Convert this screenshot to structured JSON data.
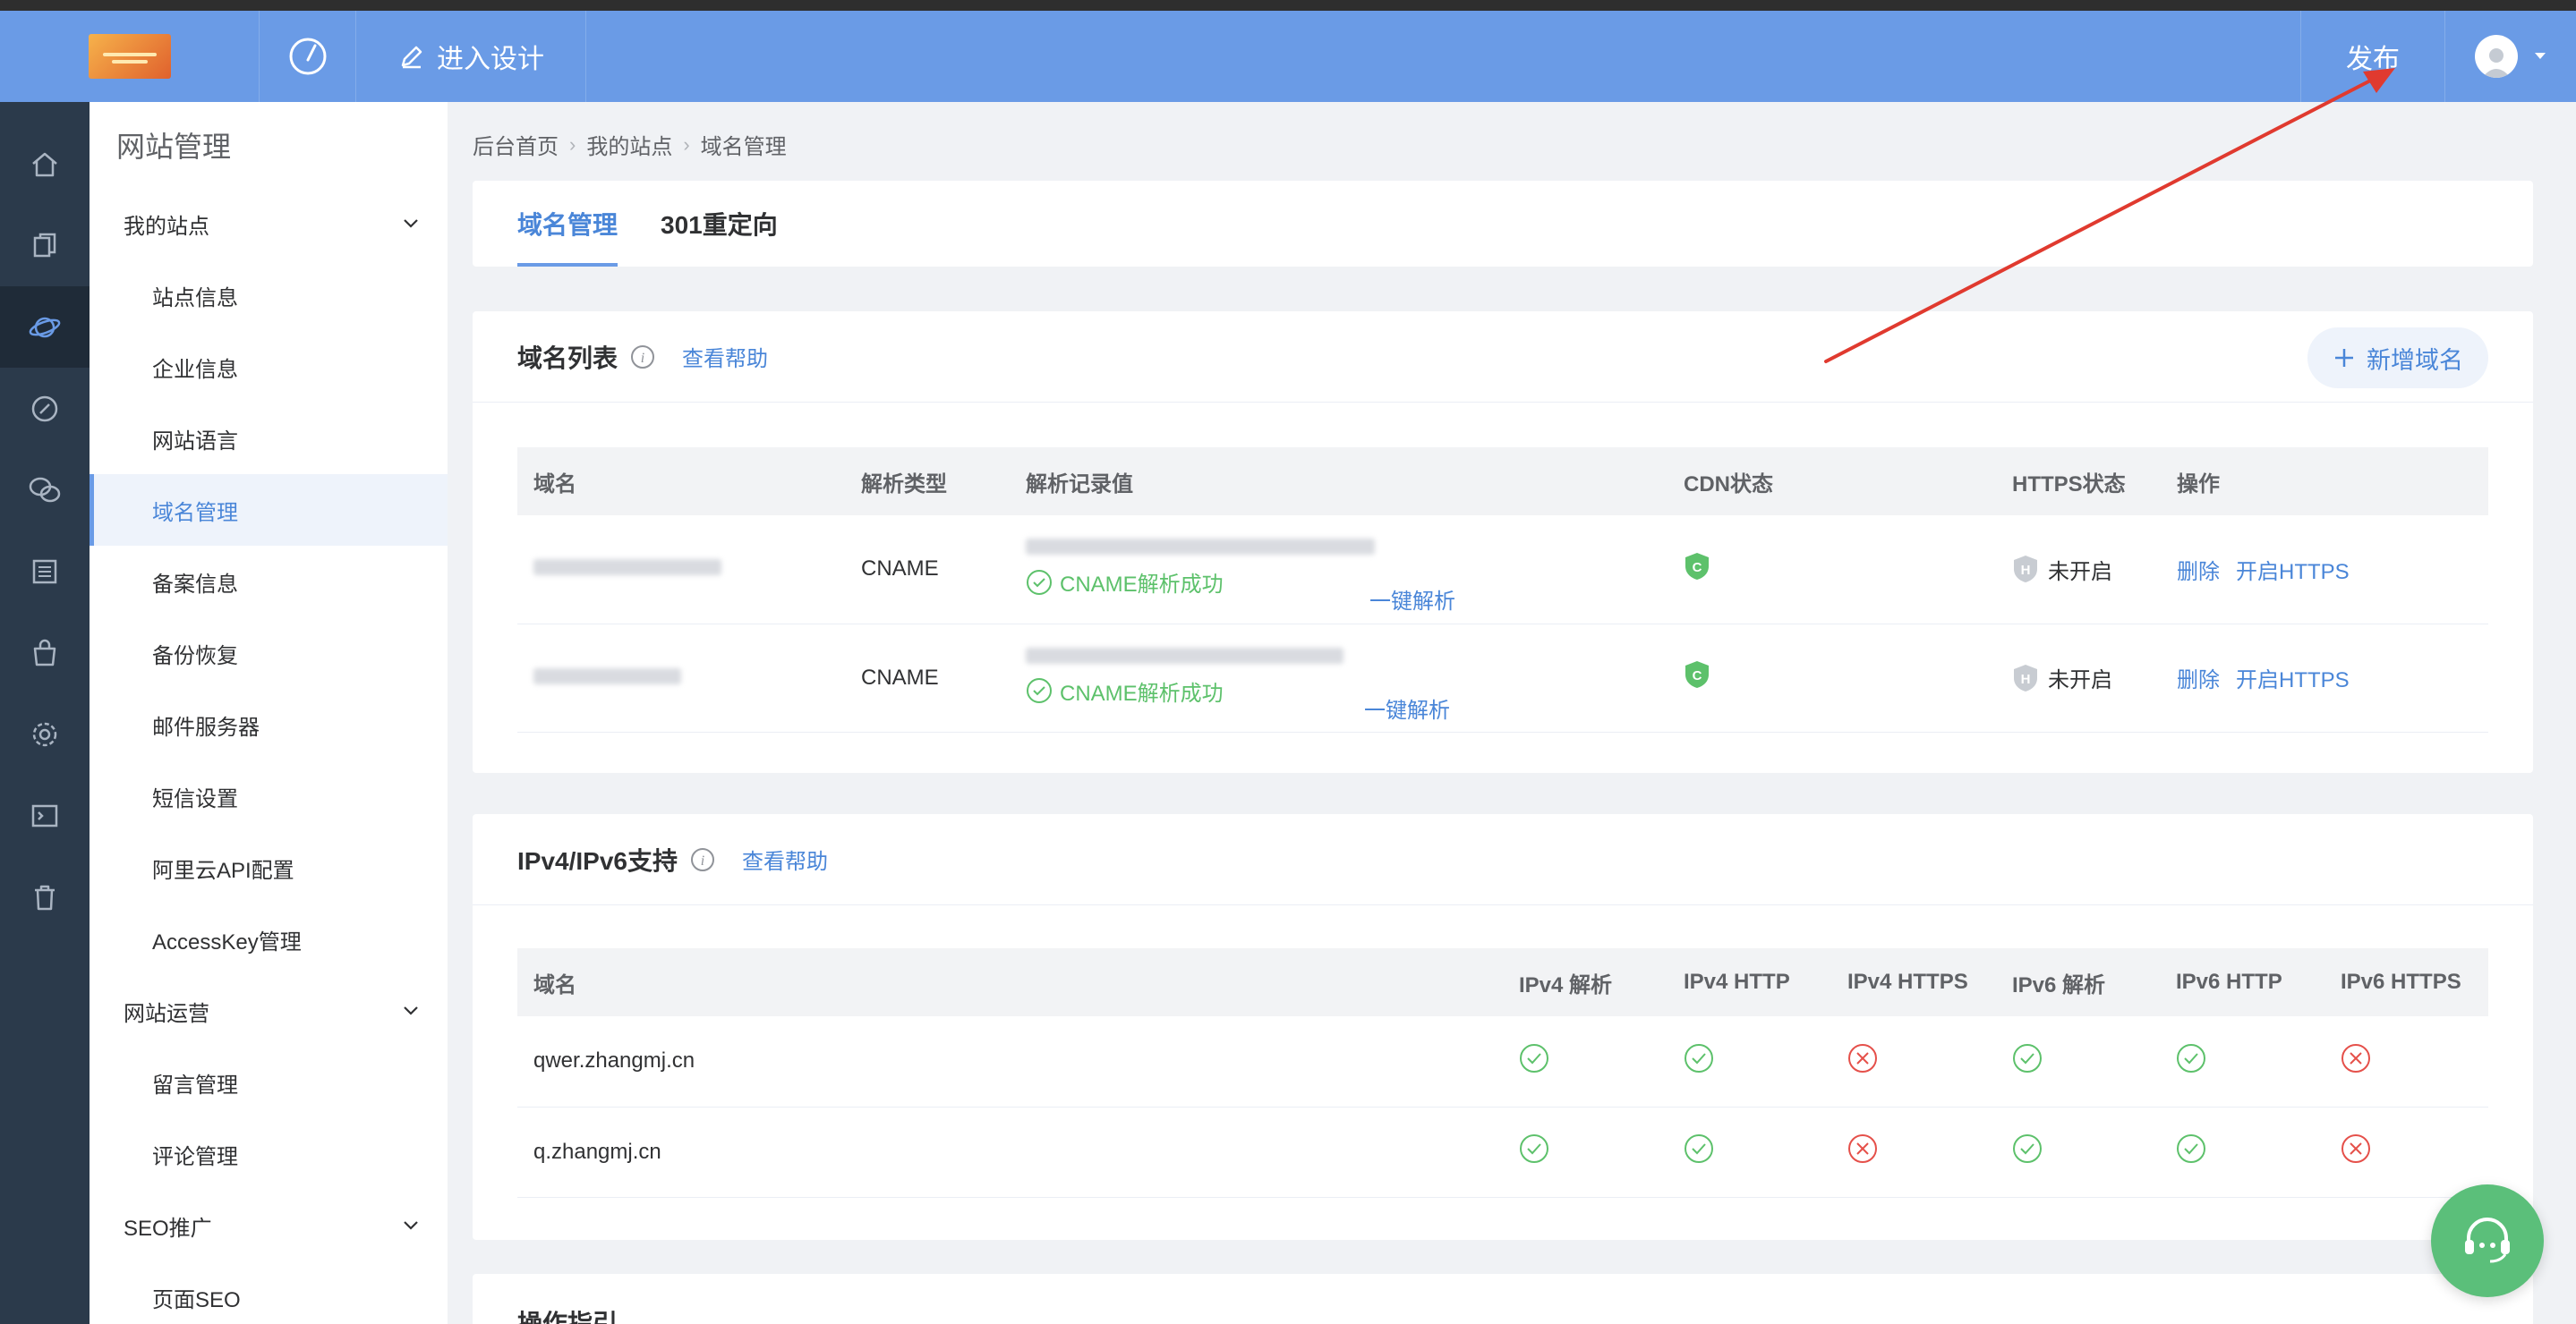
{
  "header": {
    "design_label": "进入设计",
    "publish_label": "发布"
  },
  "sidebar": {
    "title": "网站管理",
    "groups": [
      {
        "label": "我的站点"
      },
      {
        "label": "网站运营"
      },
      {
        "label": "SEO推广"
      }
    ],
    "items": [
      {
        "label": "站点信息"
      },
      {
        "label": "企业信息"
      },
      {
        "label": "网站语言"
      },
      {
        "label": "域名管理"
      },
      {
        "label": "备案信息"
      },
      {
        "label": "备份恢复"
      },
      {
        "label": "邮件服务器"
      },
      {
        "label": "短信设置"
      },
      {
        "label": "阿里云API配置"
      },
      {
        "label": "AccessKey管理"
      },
      {
        "label": "留言管理"
      },
      {
        "label": "评论管理"
      },
      {
        "label": "页面SEO"
      }
    ]
  },
  "breadcrumb": [
    "后台首页",
    "我的站点",
    "域名管理"
  ],
  "tabs": [
    {
      "label": "域名管理"
    },
    {
      "label": "301重定向"
    }
  ],
  "domain_list": {
    "title": "域名列表",
    "help": "查看帮助",
    "add_label": "新增域名",
    "headers": [
      "域名",
      "解析类型",
      "解析记录值",
      "CDN状态",
      "HTTPS状态",
      "操作"
    ],
    "rows": [
      {
        "type": "CNAME",
        "status": "CNAME解析成功",
        "one_click": "一键解析",
        "cdn": "C",
        "https_icon": "H",
        "https": "未开启",
        "delete": "删除",
        "enable": "开启HTTPS"
      },
      {
        "type": "CNAME",
        "status": "CNAME解析成功",
        "one_click": "一键解析",
        "cdn": "C",
        "https_icon": "H",
        "https": "未开启",
        "delete": "删除",
        "enable": "开启HTTPS"
      }
    ]
  },
  "ip_support": {
    "title": "IPv4/IPv6支持",
    "help": "查看帮助",
    "headers": [
      "域名",
      "IPv4 解析",
      "IPv4 HTTP",
      "IPv4 HTTPS",
      "IPv6 解析",
      "IPv6 HTTP",
      "IPv6 HTTPS"
    ],
    "rows": [
      {
        "domain": "qwer.zhangmj.cn"
      },
      {
        "domain": "q.zhangmj.cn"
      }
    ]
  },
  "guide": {
    "title": "操作指引"
  },
  "colors": {
    "accent": "#6a9be6",
    "sidebar_dark": "#2b3a4b",
    "success": "#5dc16b",
    "error": "#e5504a"
  }
}
